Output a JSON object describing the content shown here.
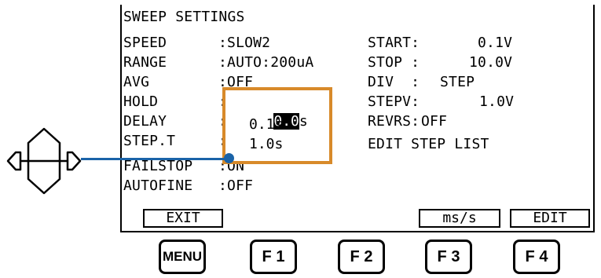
{
  "screen": {
    "title": "SWEEP SETTINGS",
    "left_rows": [
      {
        "label": "SPEED",
        "value": ":SLOW2"
      },
      {
        "label": "RANGE",
        "value": ":AUTO:200uA"
      },
      {
        "label": "AVG",
        "value": ":OFF"
      },
      {
        "label": "HOLD",
        "value": ":"
      },
      {
        "label": "DELAY",
        "value": ":"
      },
      {
        "label": "STEP.T",
        "value": ":"
      },
      {
        "label": "FAILSTOP",
        "value": ":ON"
      },
      {
        "label": "AUTOFINE",
        "value": ":OFF"
      }
    ],
    "right_rows": [
      {
        "label": "START:",
        "value": "0.1V"
      },
      {
        "label": "STOP :",
        "value": "10.0V"
      },
      {
        "label": "DIV  :",
        "value": "STEP"
      },
      {
        "label": "STEPV:",
        "value": "1.0V"
      },
      {
        "label": "REVRS:",
        "value": "OFF"
      },
      {
        "label": "EDIT STEP LIST",
        "value": ""
      }
    ],
    "popup": {
      "hold_selected": "0.0",
      "hold_unit": "s",
      "delay": "0.1s",
      "step_t": "1.0s"
    },
    "softkeys": {
      "f1": "EXIT",
      "f2": "",
      "f3": "ms/s",
      "f4": "EDIT"
    }
  },
  "hardware_buttons": {
    "menu": "MENU",
    "f1": "F 1",
    "f2": "F 2",
    "f3": "F 3",
    "f4": "F 4"
  },
  "colors": {
    "popup_border": "#d88a2a",
    "connector": "#1a63a8",
    "lcd_text": "#000000"
  },
  "icons": {
    "dpad": "dpad-left-up-right-down-icon"
  }
}
